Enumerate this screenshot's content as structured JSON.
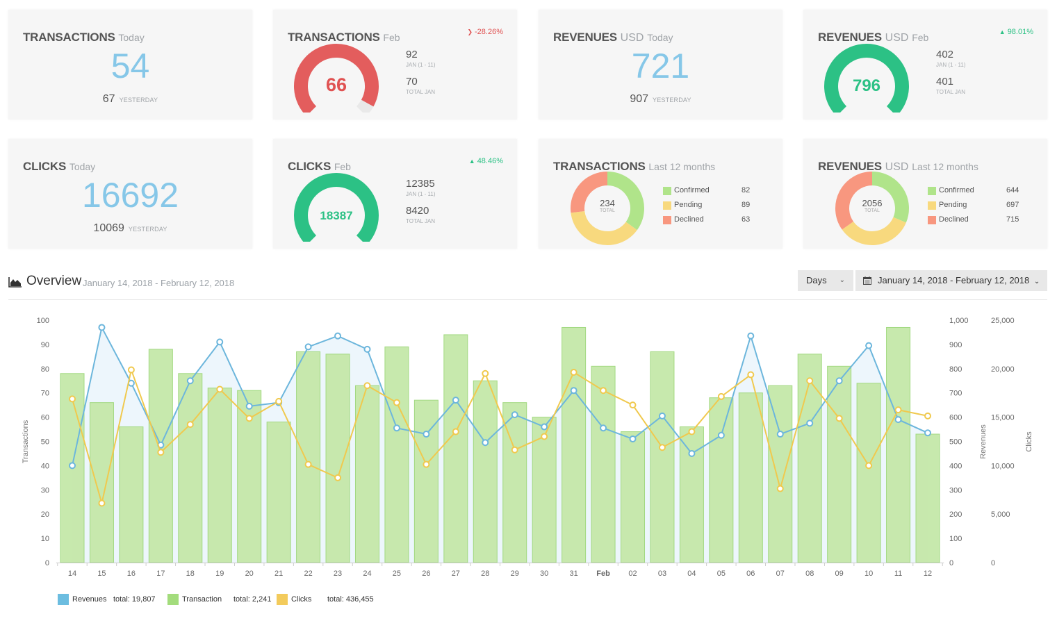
{
  "colors": {
    "card_bg": "#f6f6f6",
    "blue": "#86c7e8",
    "red": "#e05a5a",
    "green": "#2cc185",
    "donut_confirmed": "#b0e48a",
    "donut_pending": "#f8d97e",
    "donut_declined": "#f8977f",
    "bar_fill": "#c5e8a9",
    "bar_stroke": "#9ed77b",
    "revenue_line": "#6cb6dc",
    "clicks_line": "#f0c94e"
  },
  "cards": {
    "transactions_today": {
      "title": "TRANSACTIONS",
      "period": "Today",
      "value": "54",
      "yesterday_value": "67",
      "yesterday_label": "YESTERDAY"
    },
    "transactions_feb": {
      "title": "TRANSACTIONS",
      "period": "Feb",
      "delta": "-28.26%",
      "delta_dir": "down",
      "gauge_value": "66",
      "gauge_fraction": 0.94,
      "stat1_value": "92",
      "stat1_label": "JAN (1 - 11)",
      "stat2_value": "70",
      "stat2_label": "TOTAL JAN"
    },
    "revenues_today": {
      "title": "REVENUES",
      "unit": "USD",
      "period": "Today",
      "value": "721",
      "yesterday_value": "907",
      "yesterday_label": "YESTERDAY"
    },
    "revenues_feb": {
      "title": "REVENUES",
      "unit": "USD",
      "period": "Feb",
      "delta": "98.01%",
      "delta_dir": "up",
      "gauge_value": "796",
      "gauge_fraction": 1.0,
      "stat1_value": "402",
      "stat1_label": "JAN (1 - 11)",
      "stat2_value": "401",
      "stat2_label": "TOTAL JAN"
    },
    "clicks_today": {
      "title": "CLICKS",
      "period": "Today",
      "value": "16692",
      "yesterday_value": "10069",
      "yesterday_label": "YESTERDAY"
    },
    "clicks_feb": {
      "title": "CLICKS",
      "period": "Feb",
      "delta": "48.46%",
      "delta_dir": "up",
      "gauge_value": "18387",
      "gauge_fraction": 1.0,
      "stat1_value": "12385",
      "stat1_label": "JAN (1 - 11)",
      "stat2_value": "8420",
      "stat2_label": "TOTAL JAN"
    },
    "transactions_12m": {
      "title": "TRANSACTIONS",
      "period": "Last 12 months",
      "total": "234",
      "total_label": "TOTAL",
      "items": [
        {
          "label": "Confirmed",
          "value": 82
        },
        {
          "label": "Pending",
          "value": 89
        },
        {
          "label": "Declined",
          "value": 63
        }
      ]
    },
    "revenues_12m": {
      "title": "REVENUES",
      "unit": "USD",
      "period": "Last 12 months",
      "total": "2056",
      "total_label": "TOTAL",
      "items": [
        {
          "label": "Confirmed",
          "value": 644
        },
        {
          "label": "Pending",
          "value": 697
        },
        {
          "label": "Declined",
          "value": 715
        }
      ]
    }
  },
  "overview": {
    "title": "Overview",
    "range": "January 14, 2018 - February 12, 2018",
    "granularity": "Days",
    "date_picker_value": "January 14, 2018 - February 12, 2018"
  },
  "chart_data": {
    "type": "bar",
    "title": "Overview",
    "categories": [
      "14",
      "15",
      "16",
      "17",
      "18",
      "19",
      "20",
      "21",
      "22",
      "23",
      "24",
      "25",
      "26",
      "27",
      "28",
      "29",
      "30",
      "31",
      "Feb",
      "02",
      "03",
      "04",
      "05",
      "06",
      "07",
      "08",
      "09",
      "10",
      "11",
      "12"
    ],
    "series": [
      {
        "name": "Transactions",
        "type": "bar",
        "axis": "left",
        "values": [
          78,
          66,
          56,
          88,
          78,
          72,
          71,
          58,
          87,
          86,
          73,
          89,
          67,
          94,
          75,
          66,
          60,
          97,
          81,
          54,
          87,
          56,
          68,
          70,
          73,
          86,
          81,
          74,
          97,
          53
        ]
      },
      {
        "name": "Revenues",
        "type": "area-line",
        "axis": "right1",
        "values": [
          400,
          970,
          740,
          485,
          750,
          910,
          645,
          660,
          890,
          935,
          880,
          555,
          530,
          670,
          495,
          610,
          560,
          710,
          555,
          510,
          605,
          450,
          525,
          935,
          530,
          575,
          750,
          895,
          590,
          535
        ]
      },
      {
        "name": "Clicks",
        "type": "line",
        "axis": "right2",
        "values": [
          16875,
          6125,
          19875,
          11375,
          14250,
          17875,
          14875,
          16625,
          10125,
          8750,
          18250,
          16500,
          10125,
          13500,
          19500,
          11625,
          13000,
          19625,
          17750,
          16250,
          11875,
          13500,
          17125,
          19375,
          7625,
          18750,
          14875,
          10000,
          15750,
          15125
        ]
      }
    ],
    "axes": {
      "left": {
        "label": "Transactions",
        "range": [
          0,
          100
        ],
        "ticks": [
          "0",
          "10",
          "20",
          "30",
          "40",
          "50",
          "60",
          "70",
          "80",
          "90",
          "100"
        ]
      },
      "right1": {
        "label": "Revenues",
        "range": [
          0,
          1000
        ],
        "ticks": [
          "0",
          "100",
          "200",
          "300",
          "400",
          "500",
          "600",
          "700",
          "800",
          "900",
          "1,000"
        ]
      },
      "right2": {
        "label": "Clicks",
        "range": [
          0,
          25000
        ],
        "ticks": [
          "0",
          "5,000",
          "10,000",
          "15,000",
          "20,000",
          "25,000"
        ]
      }
    },
    "legend": {
      "placement": "bottom-left",
      "items": [
        {
          "label": "Revenues",
          "total": "total: 19,807",
          "color": "#6cbde0"
        },
        {
          "label": "Transaction",
          "total": "total: 2,241",
          "color": "#a3dc7c"
        },
        {
          "label": "Clicks",
          "total": "total: 436,455",
          "color": "#f3cb5c"
        }
      ]
    },
    "grid": false
  }
}
